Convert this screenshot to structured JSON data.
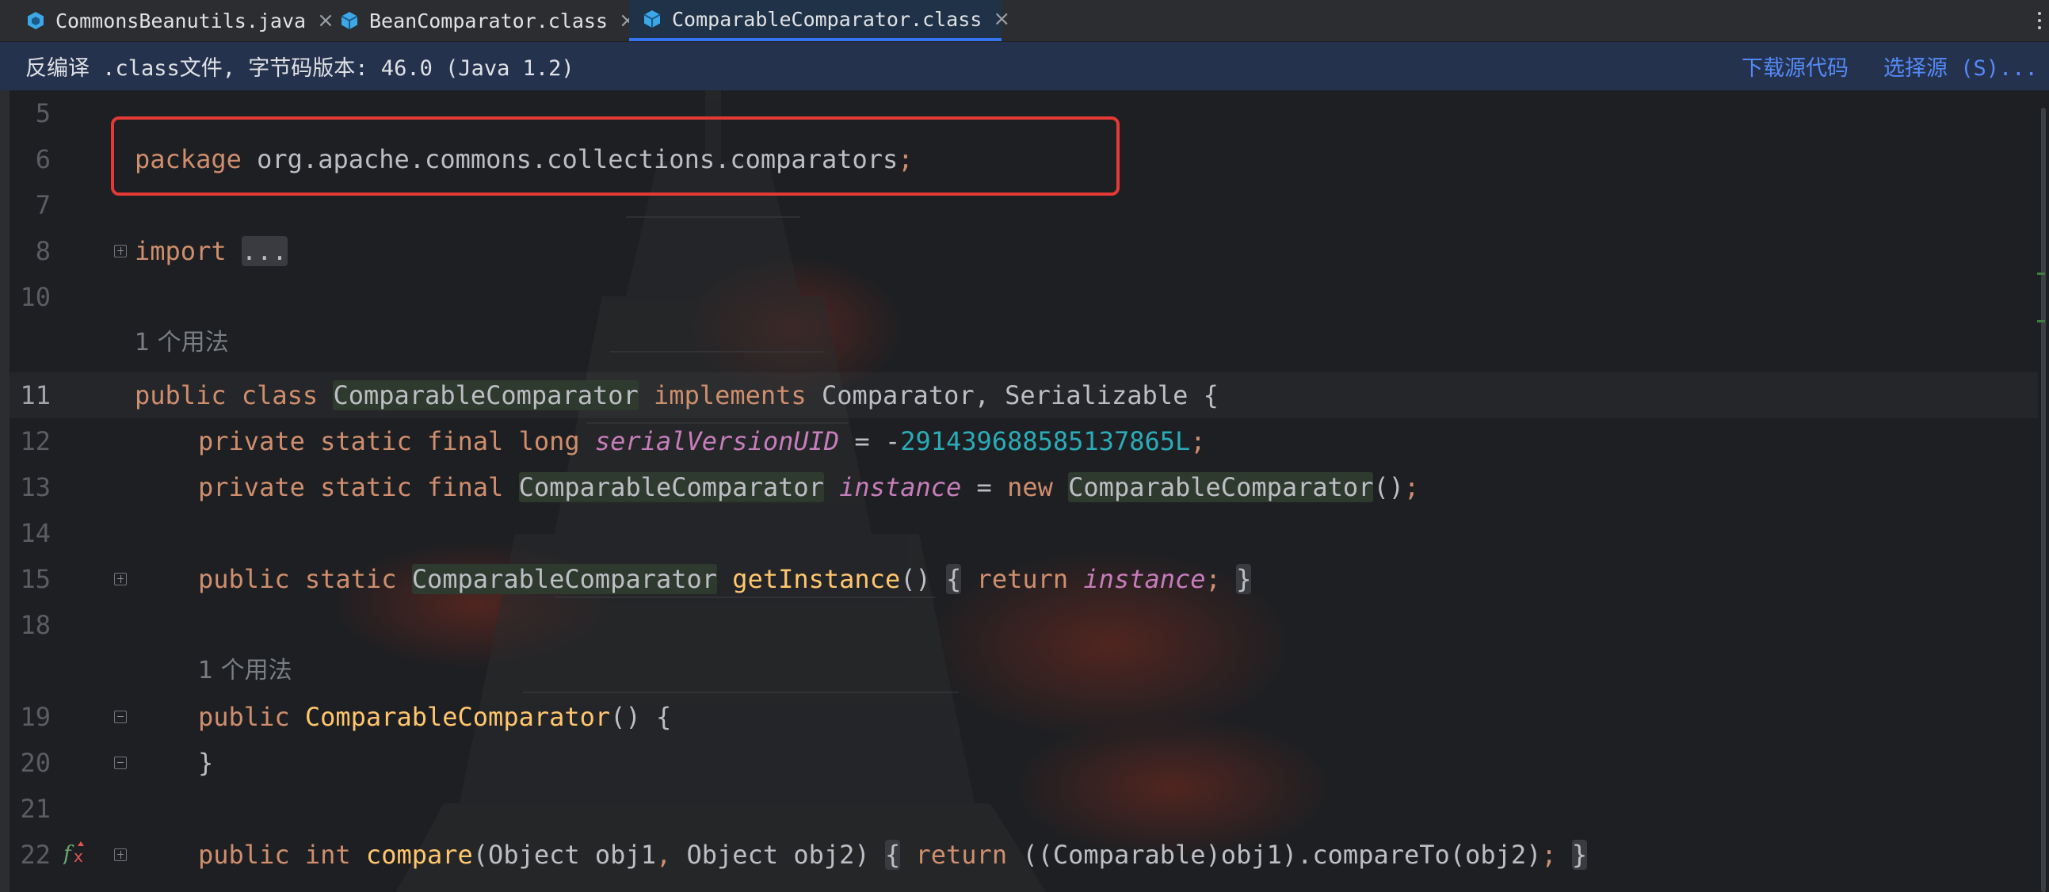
{
  "tabs": [
    {
      "label": "CommonsBeanutils.java",
      "icon": "java-class-icon",
      "active": false
    },
    {
      "label": "BeanComparator.class",
      "icon": "class-file-icon",
      "active": false
    },
    {
      "label": "ComparableComparator.class",
      "icon": "class-file-icon",
      "active": true
    }
  ],
  "tab_close": "×",
  "banner": {
    "text": "反编译 .class文件, 字节码版本: 46.0 (Java 1.2)",
    "download_link": "下载源代码",
    "select_link": "选择源 (S)..."
  },
  "editor": {
    "line_numbers": [
      "5",
      "6",
      "7",
      "8",
      "10",
      "",
      "11",
      "12",
      "13",
      "14",
      "15",
      "18",
      "",
      "19",
      "20",
      "21",
      "22"
    ],
    "usage_hint": "1 个用法",
    "lines": {
      "l6": {
        "kw": "package",
        "rest": " org.apache.commons.collections.comparators",
        "semi": ";"
      },
      "l8": {
        "kw": "import",
        "fold": "..."
      },
      "l11": {
        "kw1": "public",
        "kw2": "class",
        "cls": "ComparableComparator",
        "kw3": "implements",
        "rest": "Comparator, Serializable {"
      },
      "l12": {
        "kw": "private static final long",
        "field": "serialVersionUID",
        "eq": " = -",
        "num": "2914396885851378​65L",
        "semi": ";"
      },
      "l13": {
        "kw": "private static final",
        "cls": "ComparableComparator",
        "field": "instance",
        "eq": " = ",
        "kw2": "new",
        "cls2": "ComparableComparator",
        "tail": "()",
        "semi": ";"
      },
      "l15": {
        "kw": "public static",
        "cls": "ComparableComparator",
        "method": "getInstance",
        "paren": "()",
        "body_open": "{",
        "kw2": "return",
        "field": "instance",
        "semi": ";",
        "body_close": "}"
      },
      "l19": {
        "kw": "public",
        "method": "ComparableComparator",
        "rest": "() {"
      },
      "l20": {
        "rest": "}"
      },
      "l22": {
        "kw": "public int",
        "method": "compare",
        "params_a": "(Object obj1",
        "comma": ",",
        "params_b": " Object obj2)",
        "body_open": "{",
        "kw2": "return",
        "expr": "((Comparable)obj1).compareTo(obj2)",
        "semi": ";",
        "body_close": "}"
      }
    }
  },
  "colors": {
    "keyword": "#cf8e6d",
    "method_decl": "#ffc66d",
    "field": "#c77dbb",
    "number": "#2aacb8",
    "link": "#548af7",
    "highlight_box": "#e53935"
  }
}
